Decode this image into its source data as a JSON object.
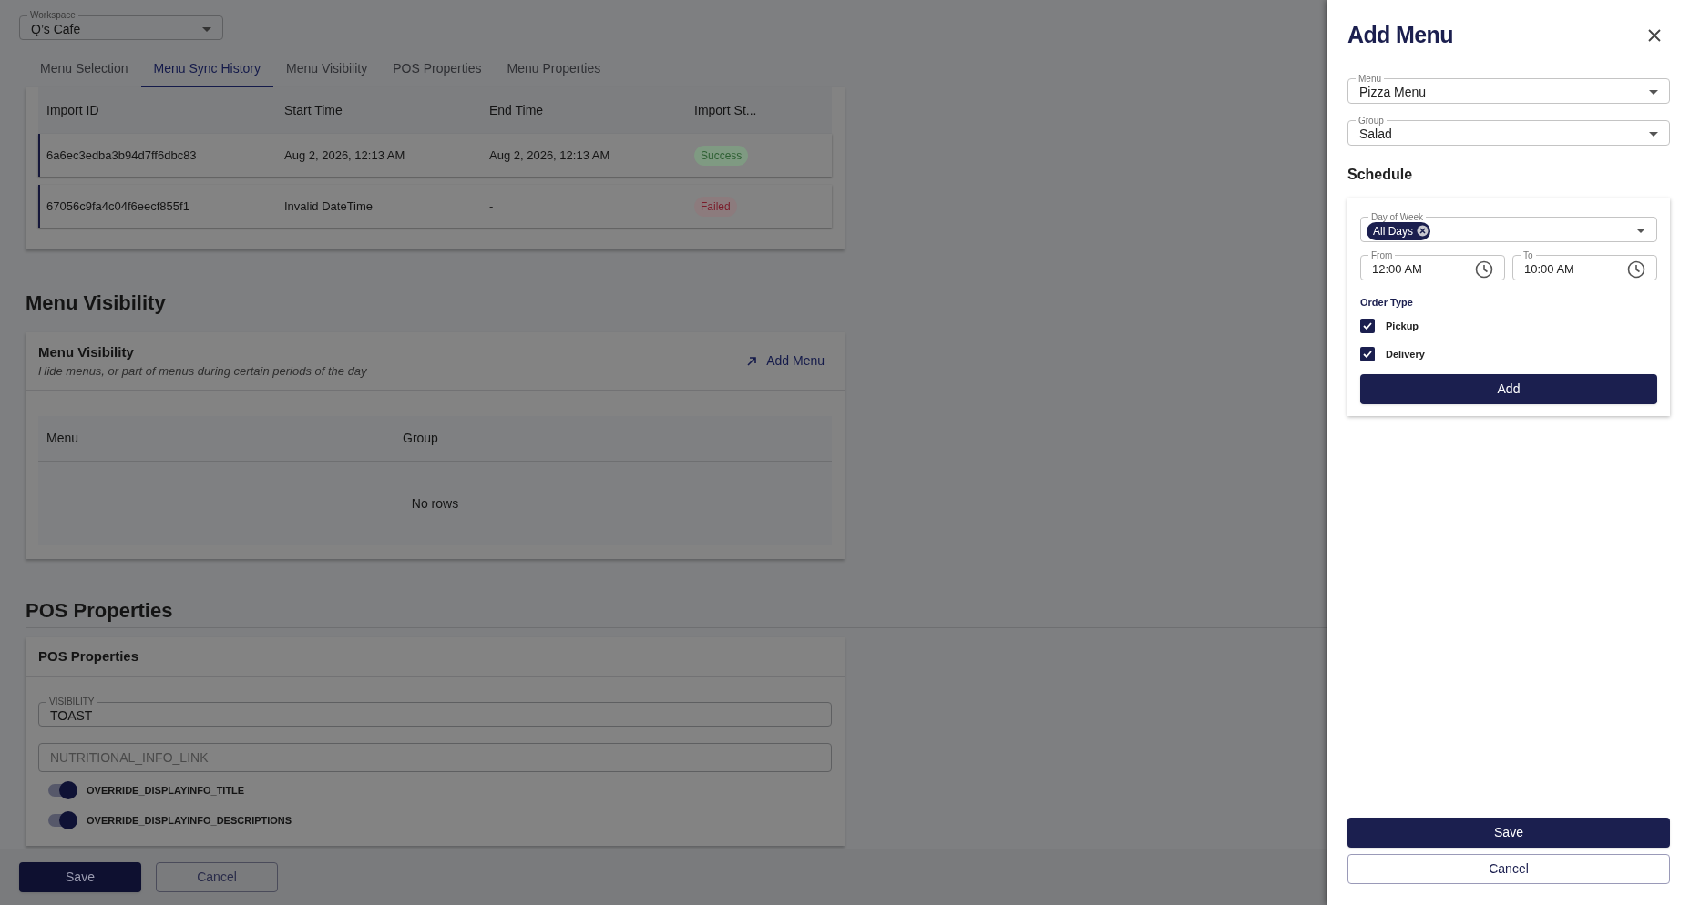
{
  "workspace": {
    "label": "Workspace",
    "value": "Q’s Cafe"
  },
  "tabs": [
    {
      "label": "Menu Selection",
      "selected": false
    },
    {
      "label": "Menu Sync History",
      "selected": true
    },
    {
      "label": "Menu Visibility",
      "selected": false
    },
    {
      "label": "POS Properties",
      "selected": false
    },
    {
      "label": "Menu Properties",
      "selected": false
    }
  ],
  "sync_table": {
    "columns": [
      "Import ID",
      "Start Time",
      "End Time",
      "Import St..."
    ],
    "rows": [
      {
        "cells": [
          "6a6ec3edba3b94d7ff6dbc83",
          "Aug 2, 2026, 12:13 AM",
          "Aug 2, 2026, 12:13 AM"
        ],
        "status": {
          "text": "Success",
          "kind": "success"
        }
      },
      {
        "cells": [
          "67056c9fa4c04f6eecf855f1",
          "Invalid DateTime",
          "-"
        ],
        "status": {
          "text": "Failed",
          "kind": "failed"
        }
      }
    ]
  },
  "menu_visibility": {
    "heading": "Menu Visibility",
    "title": "Menu Visibility",
    "subtitle": "Hide menus, or part of menus during certain periods of the day",
    "action": "Add Menu",
    "columns": [
      "Menu",
      "Group"
    ],
    "empty": "No rows"
  },
  "pos_properties": {
    "heading": "POS Properties",
    "title": "POS Properties",
    "fields": [
      {
        "label": "VISIBILITY",
        "value": "TOAST"
      },
      {
        "placeholder": "NUTRITIONAL_INFO_LINK"
      }
    ],
    "toggles": [
      {
        "label": "OVERRIDE_DISPLAYINFO_TITLE",
        "on": true
      },
      {
        "label": "OVERRIDE_DISPLAYINFO_DESCRIPTIONS",
        "on": true
      }
    ]
  },
  "footer": {
    "save": "Save",
    "cancel": "Cancel"
  },
  "drawer": {
    "title": "Add Menu",
    "menu": {
      "label": "Menu",
      "value": "Pizza Menu"
    },
    "group": {
      "label": "Group",
      "value": "Salad"
    },
    "schedule": {
      "heading": "Schedule",
      "day_of_week": {
        "label": "Day of Week",
        "chips": [
          "All Days"
        ]
      },
      "from": {
        "label": "From",
        "value": "12:00 AM"
      },
      "to": {
        "label": "To",
        "value": "10:00 AM"
      },
      "order_type": {
        "label": "Order Type",
        "options": [
          {
            "label": "Pickup",
            "checked": true
          },
          {
            "label": "Delivery",
            "checked": true
          }
        ]
      },
      "add": "Add"
    },
    "save": "Save",
    "cancel": "Cancel"
  }
}
